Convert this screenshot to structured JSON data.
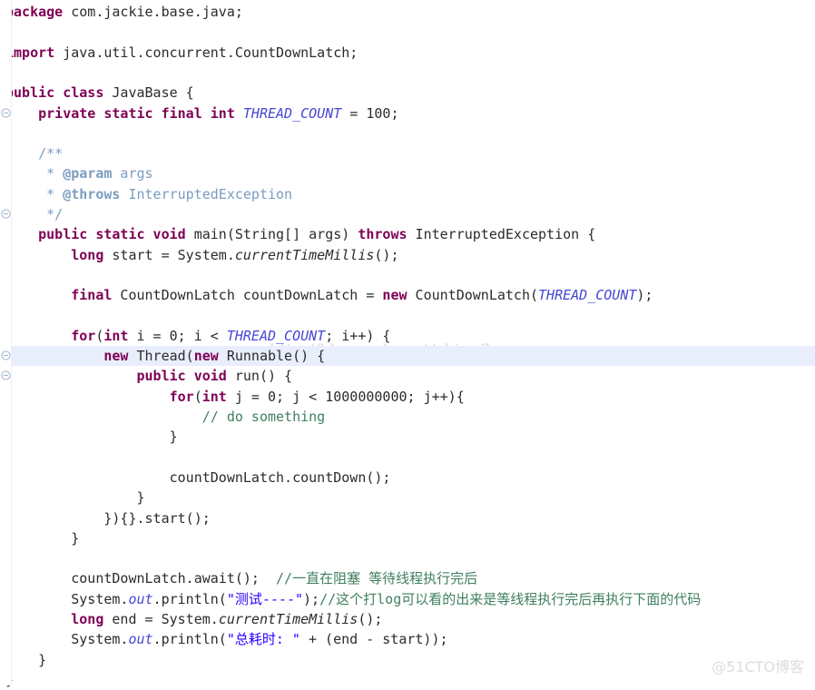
{
  "editor": {
    "file_title": "JavaBase.java",
    "language": "java",
    "background_color": "#ffffff",
    "highlighted_line_index": 17,
    "highlight_color": "#e8eefb",
    "colors": {
      "keyword": "#7f0055",
      "plain": "#2b2b2b",
      "string": "#2a00ff",
      "comment": "#3f7f5f",
      "javadoc": "#7b9cc0",
      "static_field": "#4646d2",
      "gutter_line": "#f0eef2"
    }
  },
  "gutter": {
    "fold_marker_icon": "fold-collapse-icon",
    "fold_marker_line_indices": [
      5,
      10,
      17,
      18
    ]
  },
  "watermarks": {
    "url": "http://blog.csdn.net/shineflowers",
    "brand": "@51CTO博客"
  },
  "code": {
    "lines": [
      {
        "i": 0,
        "indent": 0,
        "tokens": [
          {
            "t": "kw",
            "v": "package"
          },
          {
            "t": "plain",
            "v": " com.jackie.base.java;"
          }
        ]
      },
      {
        "i": 1,
        "indent": 0,
        "tokens": []
      },
      {
        "i": 2,
        "indent": 0,
        "tokens": [
          {
            "t": "kw",
            "v": "import"
          },
          {
            "t": "plain",
            "v": " java.util.concurrent.CountDownLatch;"
          }
        ]
      },
      {
        "i": 3,
        "indent": 0,
        "tokens": []
      },
      {
        "i": 4,
        "indent": 0,
        "tokens": [
          {
            "t": "kw",
            "v": "public class"
          },
          {
            "t": "plain",
            "v": " JavaBase {"
          }
        ]
      },
      {
        "i": 5,
        "indent": 0,
        "tokens": [
          {
            "t": "plain",
            "v": "    "
          },
          {
            "t": "kw",
            "v": "private static final int"
          },
          {
            "t": "plain",
            "v": " "
          },
          {
            "t": "sfield",
            "v": "THREAD_COUNT"
          },
          {
            "t": "plain",
            "v": " = 100;"
          }
        ]
      },
      {
        "i": 6,
        "indent": 0,
        "tokens": []
      },
      {
        "i": 7,
        "indent": 0,
        "tokens": [
          {
            "t": "doc",
            "v": "    /**"
          }
        ]
      },
      {
        "i": 8,
        "indent": 0,
        "tokens": [
          {
            "t": "doc",
            "v": "     * "
          },
          {
            "t": "doctag",
            "v": "@param"
          },
          {
            "t": "doc",
            "v": " args"
          }
        ]
      },
      {
        "i": 9,
        "indent": 0,
        "tokens": [
          {
            "t": "doc",
            "v": "     * "
          },
          {
            "t": "doctag",
            "v": "@throws"
          },
          {
            "t": "doc",
            "v": " InterruptedException"
          }
        ]
      },
      {
        "i": 10,
        "indent": 0,
        "tokens": [
          {
            "t": "doc",
            "v": "     */"
          }
        ]
      },
      {
        "i": 11,
        "indent": 0,
        "tokens": [
          {
            "t": "plain",
            "v": "    "
          },
          {
            "t": "kw",
            "v": "public static void"
          },
          {
            "t": "plain",
            "v": " main(String[] args) "
          },
          {
            "t": "kw",
            "v": "throws"
          },
          {
            "t": "plain",
            "v": " InterruptedException {"
          }
        ]
      },
      {
        "i": 12,
        "indent": 0,
        "tokens": [
          {
            "t": "plain",
            "v": "        "
          },
          {
            "t": "kw",
            "v": "long"
          },
          {
            "t": "plain",
            "v": " start = System."
          },
          {
            "t": "smeth",
            "v": "currentTimeMillis"
          },
          {
            "t": "plain",
            "v": "();"
          }
        ]
      },
      {
        "i": 13,
        "indent": 0,
        "tokens": []
      },
      {
        "i": 14,
        "indent": 0,
        "tokens": [
          {
            "t": "plain",
            "v": "        "
          },
          {
            "t": "kw",
            "v": "final"
          },
          {
            "t": "plain",
            "v": " CountDownLatch countDownLatch = "
          },
          {
            "t": "kw",
            "v": "new"
          },
          {
            "t": "plain",
            "v": " CountDownLatch("
          },
          {
            "t": "sfield",
            "v": "THREAD_COUNT"
          },
          {
            "t": "plain",
            "v": ");"
          }
        ]
      },
      {
        "i": 15,
        "indent": 0,
        "tokens": []
      },
      {
        "i": 16,
        "indent": 0,
        "tokens": [
          {
            "t": "plain",
            "v": "        "
          },
          {
            "t": "kw",
            "v": "for"
          },
          {
            "t": "plain",
            "v": "("
          },
          {
            "t": "kw",
            "v": "int"
          },
          {
            "t": "plain",
            "v": " i = 0; i < "
          },
          {
            "t": "sfield",
            "v": "THREAD_COUNT"
          },
          {
            "t": "plain",
            "v": "; i++) {"
          }
        ]
      },
      {
        "i": 17,
        "indent": 0,
        "tokens": [
          {
            "t": "plain",
            "v": "            "
          },
          {
            "t": "kw",
            "v": "new"
          },
          {
            "t": "plain",
            "v": " Thread("
          },
          {
            "t": "kw",
            "v": "new"
          },
          {
            "t": "plain",
            "v": " Runnable() {"
          }
        ]
      },
      {
        "i": 18,
        "indent": 0,
        "tokens": [
          {
            "t": "plain",
            "v": "                "
          },
          {
            "t": "kw",
            "v": "public void"
          },
          {
            "t": "plain",
            "v": " run() {"
          }
        ]
      },
      {
        "i": 19,
        "indent": 0,
        "tokens": [
          {
            "t": "plain",
            "v": "                    "
          },
          {
            "t": "kw",
            "v": "for"
          },
          {
            "t": "plain",
            "v": "("
          },
          {
            "t": "kw",
            "v": "int"
          },
          {
            "t": "plain",
            "v": " j = 0; j < 1000000000; j++){"
          }
        ]
      },
      {
        "i": 20,
        "indent": 0,
        "tokens": [
          {
            "t": "plain",
            "v": "                        "
          },
          {
            "t": "cmt",
            "v": "// do something"
          }
        ]
      },
      {
        "i": 21,
        "indent": 0,
        "tokens": [
          {
            "t": "plain",
            "v": "                    }"
          }
        ]
      },
      {
        "i": 22,
        "indent": 0,
        "tokens": []
      },
      {
        "i": 23,
        "indent": 0,
        "tokens": [
          {
            "t": "plain",
            "v": "                    countDownLatch.countDown();"
          }
        ]
      },
      {
        "i": 24,
        "indent": 0,
        "tokens": [
          {
            "t": "plain",
            "v": "                }"
          }
        ]
      },
      {
        "i": 25,
        "indent": 0,
        "tokens": [
          {
            "t": "plain",
            "v": "            }){}.start();"
          }
        ]
      },
      {
        "i": 26,
        "indent": 0,
        "tokens": [
          {
            "t": "plain",
            "v": "        }"
          }
        ]
      },
      {
        "i": 27,
        "indent": 0,
        "tokens": []
      },
      {
        "i": 28,
        "indent": 0,
        "tokens": [
          {
            "t": "plain",
            "v": "        countDownLatch.await();  "
          },
          {
            "t": "cmt",
            "v": "//一直在阻塞 等待线程执行完后"
          }
        ]
      },
      {
        "i": 29,
        "indent": 0,
        "tokens": [
          {
            "t": "plain",
            "v": "        System."
          },
          {
            "t": "sfield",
            "v": "out"
          },
          {
            "t": "plain",
            "v": ".println("
          },
          {
            "t": "str",
            "v": "\"测试----\""
          },
          {
            "t": "plain",
            "v": ");"
          },
          {
            "t": "cmt",
            "v": "//这个打log可以看的出来是等线程执行完后再执行下面的代码"
          }
        ]
      },
      {
        "i": 30,
        "indent": 0,
        "tokens": [
          {
            "t": "plain",
            "v": "        "
          },
          {
            "t": "kw",
            "v": "long"
          },
          {
            "t": "plain",
            "v": " end = System."
          },
          {
            "t": "smeth",
            "v": "currentTimeMillis"
          },
          {
            "t": "plain",
            "v": "();"
          }
        ]
      },
      {
        "i": 31,
        "indent": 0,
        "tokens": [
          {
            "t": "plain",
            "v": "        System."
          },
          {
            "t": "sfield",
            "v": "out"
          },
          {
            "t": "plain",
            "v": ".println("
          },
          {
            "t": "str",
            "v": "\"总耗时: \""
          },
          {
            "t": "plain",
            "v": " + (end - start));"
          }
        ]
      },
      {
        "i": 32,
        "indent": 0,
        "tokens": [
          {
            "t": "plain",
            "v": "    }"
          }
        ]
      },
      {
        "i": 33,
        "indent": 0,
        "tokens": [
          {
            "t": "plain",
            "v": "}"
          }
        ]
      }
    ]
  }
}
